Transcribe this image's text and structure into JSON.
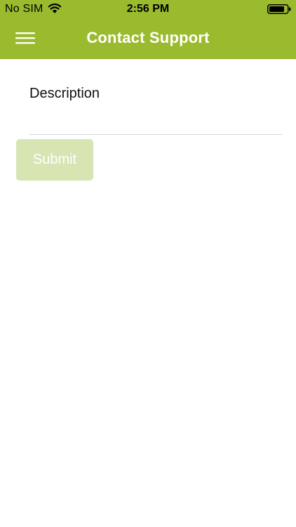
{
  "status_bar": {
    "carrier": "No SIM",
    "time": "2:56 PM",
    "wifi_icon": "wifi-icon",
    "battery_icon": "battery-icon"
  },
  "nav": {
    "title": "Contact Support",
    "menu_icon": "hamburger-menu-icon"
  },
  "form": {
    "description_label": "Description",
    "description_value": "",
    "submit_label": "Submit"
  },
  "colors": {
    "header_green": "#9bbb2f",
    "submit_disabled": "#d7e5b3",
    "divider": "#d6d6d6"
  }
}
